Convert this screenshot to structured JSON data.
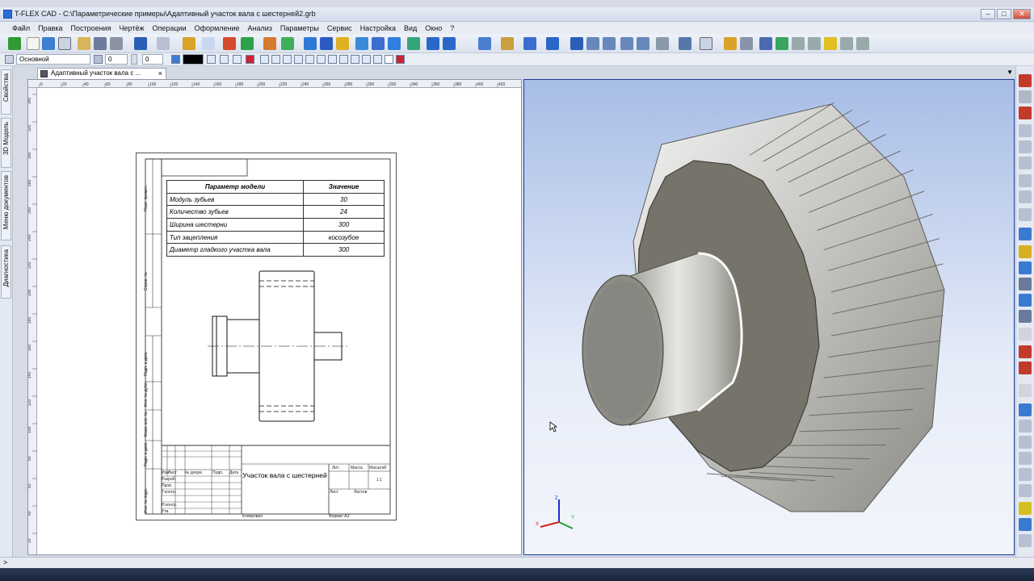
{
  "window": {
    "title": "T-FLEX CAD - C:\\Параметрические примеры\\Адаптивный участок вала с шестерней2.grb",
    "controls": {
      "minimize": "–",
      "maximize": "□",
      "close": "✕"
    }
  },
  "menu": [
    "Файл",
    "Правка",
    "Построения",
    "Чертёж",
    "Операции",
    "Оформление",
    "Анализ",
    "Параметры",
    "Сервис",
    "Настройка",
    "Вид",
    "Окно",
    "?"
  ],
  "toolbar2": {
    "style_value": "Основной",
    "layer_value": "0",
    "level_value": "0",
    "priority_value": "0",
    "color_value": "#000000"
  },
  "left_panel_tabs": [
    "Свойства",
    "3D Модель",
    "Меню документов",
    "Диагностика"
  ],
  "document_tab": {
    "label": "Адаптивный участок вала с ...",
    "close": "×"
  },
  "ruler": {
    "h_ticks": [
      "0",
      "20",
      "40",
      "60",
      "80",
      "100",
      "120",
      "140",
      "160",
      "180",
      "200",
      "220",
      "240",
      "260",
      "280",
      "300",
      "320",
      "340",
      "360",
      "380",
      "400",
      "420"
    ],
    "v_ticks": [
      "340",
      "320",
      "300",
      "280",
      "260",
      "240",
      "220",
      "200",
      "180",
      "160",
      "140",
      "120",
      "100",
      "80",
      "60",
      "40",
      "20"
    ]
  },
  "drawing": {
    "table": {
      "headers": [
        "Параметр модели",
        "Значение"
      ],
      "rows": [
        {
          "name": "Модуль зубьев",
          "value": "30"
        },
        {
          "name": "Количество зубьев",
          "value": "24"
        },
        {
          "name": "Ширина шестерни",
          "value": "300"
        },
        {
          "name": "Тип зацепления",
          "value": "косозубое"
        },
        {
          "name": "Диаметр гладкого участка вала",
          "value": "300"
        }
      ]
    },
    "side_labels": [
      "Перв. примен.",
      "Справ. №",
      "Подп. и дата",
      "Инв. № дубл.",
      "Взам. инв. №",
      "Подп. и дата",
      "Инв. № подл."
    ],
    "title_block": {
      "title": "Участок вала с шестерней",
      "cols": [
        "Изм",
        "Лист",
        "№ докум.",
        "Подп.",
        "Дата"
      ],
      "roles": [
        "Разраб.",
        "Пров.",
        "Т.контр.",
        "Н.контр.",
        "Утв."
      ],
      "lit": "Лит.",
      "mass": "Масса",
      "scale_label": "Масштаб",
      "scale_value": "1:1",
      "sheet": "Лист",
      "sheets": "Листов",
      "copied": "Копировал",
      "format": "Формат  А3"
    }
  },
  "axis_triad": {
    "z": "Z",
    "x": "X",
    "y": "Y"
  },
  "colors": {
    "accent": "#1b3f9a",
    "viewport_top": "#a7bde6",
    "gear": "#a9a89d"
  }
}
